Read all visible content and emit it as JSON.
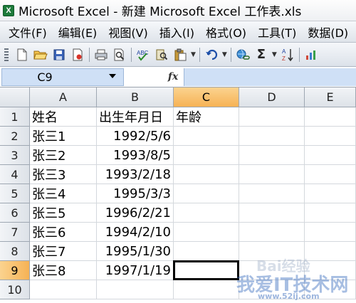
{
  "window": {
    "title": "Microsoft Excel - 新建 Microsoft Excel 工作表.xls"
  },
  "menu": [
    "文件(F)",
    "编辑(E)",
    "视图(V)",
    "插入(I)",
    "格式(O)",
    "工具(T)",
    "数据(D)"
  ],
  "toolbar": {
    "icons": [
      "new-icon",
      "open-icon",
      "save-icon",
      "permission-icon",
      "print-icon",
      "print-preview-icon",
      "spelling-icon",
      "research-icon",
      "paste-icon",
      "undo-icon",
      "hyperlink-icon",
      "autosum-icon",
      "sort-ascending-icon"
    ],
    "sigma": "Σ"
  },
  "formula_bar": {
    "name_box": "C9",
    "fx": "fx",
    "formula": ""
  },
  "sheet": {
    "columns": [
      "A",
      "B",
      "C",
      "D",
      "E"
    ],
    "active_column": "C",
    "active_row": "9",
    "rows": [
      {
        "num": "1",
        "a": "姓名",
        "b": "出生年月日",
        "c": "年龄"
      },
      {
        "num": "2",
        "a": "张三1",
        "b": "1992/5/6",
        "c": ""
      },
      {
        "num": "3",
        "a": "张三2",
        "b": "1993/8/5",
        "c": ""
      },
      {
        "num": "4",
        "a": "张三3",
        "b": "1993/2/18",
        "c": ""
      },
      {
        "num": "5",
        "a": "张三4",
        "b": "1995/3/3",
        "c": ""
      },
      {
        "num": "6",
        "a": "张三5",
        "b": "1996/2/21",
        "c": ""
      },
      {
        "num": "7",
        "a": "张三6",
        "b": "1994/2/10",
        "c": ""
      },
      {
        "num": "8",
        "a": "张三7",
        "b": "1995/1/30",
        "c": ""
      },
      {
        "num": "9",
        "a": "张三8",
        "b": "1997/1/19",
        "c": ""
      },
      {
        "num": "10",
        "a": "",
        "b": "",
        "c": ""
      }
    ]
  },
  "watermark": {
    "brand": "Bai经验",
    "site": "我爱IT技术网",
    "url": "www.52ij.com"
  },
  "colors": {
    "active_header": "#f6b255",
    "namebox_bg": "#cfe0f6"
  }
}
